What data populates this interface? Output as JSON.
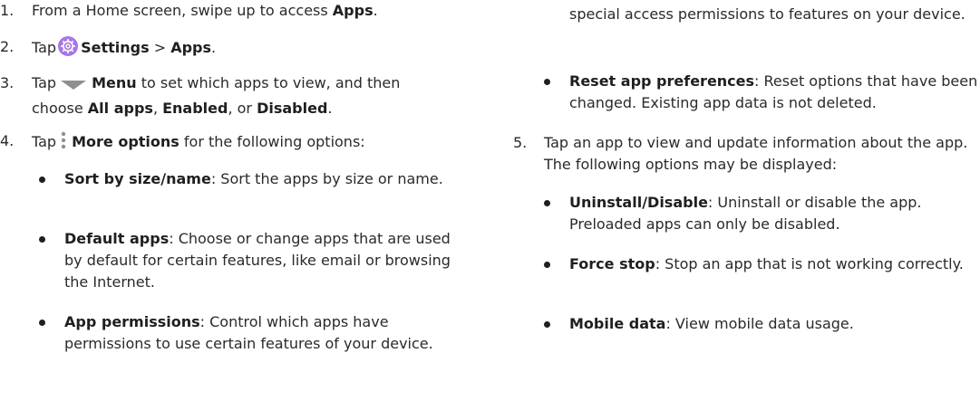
{
  "steps": [
    {
      "num": "1.",
      "pre": "From a Home screen, swipe up to access ",
      "bold": "Apps",
      "post": "."
    },
    {
      "num": "2.",
      "pre": "Tap",
      "settings": "Settings",
      "sep": " > ",
      "apps": "Apps",
      "post": "."
    },
    {
      "num": "3.",
      "pre": "Tap",
      "menu": "Menu",
      "mid": " to set which apps to view, and then choose ",
      "all": "All apps",
      "c1": ", ",
      "enabled": "Enabled",
      "c2": ", or ",
      "disabled": "Disabled",
      "post": "."
    },
    {
      "num": "4.",
      "pre": "Tap",
      "more": "More options",
      "post": " for the following options:"
    },
    {
      "num": "5.",
      "text": "Tap an app to view and update information about the app. The following options may be displayed:"
    }
  ],
  "step4_bullets": [
    {
      "term": "Sort by size/name",
      "desc": ": Sort the apps by size or name."
    },
    {
      "term": "Default apps",
      "desc": ": Choose or change apps that are used by default for certain features, like email or browsing the Internet."
    },
    {
      "term": "App permissions",
      "desc": ": Control which apps have permissions to use certain features of your device."
    }
  ],
  "continued_text": "special access permissions to features on your device.",
  "step4_bullets_cont": [
    {
      "term": "Reset app preferences",
      "desc": ": Reset options that have been changed. Existing app data is not deleted."
    }
  ],
  "step5_bullets": [
    {
      "term": "Uninstall/Disable",
      "desc": ": Uninstall or disable the app. Preloaded apps can only be disabled."
    },
    {
      "term": "Force stop",
      "desc": ": Stop an app that is not working correctly."
    },
    {
      "term": "Mobile data",
      "desc": ": View mobile data usage."
    }
  ],
  "icons": {
    "settings": "settings-gear-icon",
    "menu": "menu-triangle-icon",
    "more": "more-options-icon"
  },
  "colors": {
    "settings_icon": "#a776e8",
    "menu_icon": "#8f8f8f",
    "more_icon": "#8f8f8f"
  }
}
